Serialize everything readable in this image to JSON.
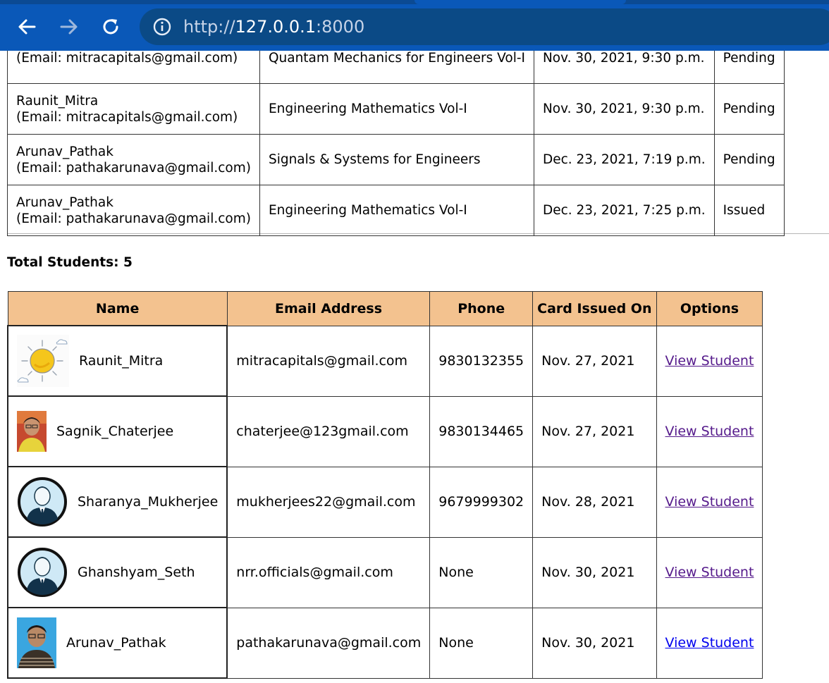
{
  "browser": {
    "url_prefix": "http://",
    "url_host": "127.0.0.1",
    "url_port": ":8000",
    "back_icon": "arrow-left-icon",
    "forward_icon": "arrow-right-icon",
    "reload_icon": "reload-icon",
    "info_icon": "info-icon"
  },
  "issue_requests": {
    "rows": [
      {
        "name": "",
        "email": "(Email: mitracapitals@gmail.com)",
        "book": "Quantam Mechanics for Engineers Vol-I",
        "date": "Nov. 30, 2021, 9:30 p.m.",
        "status": "Pending"
      },
      {
        "name": "Raunit_Mitra",
        "email": "(Email: mitracapitals@gmail.com)",
        "book": "Engineering Mathematics Vol-I",
        "date": "Nov. 30, 2021, 9:30 p.m.",
        "status": "Pending"
      },
      {
        "name": "Arunav_Pathak",
        "email": "(Email: pathakarunava@gmail.com)",
        "book": "Signals & Systems for Engineers",
        "date": "Dec. 23, 2021, 7:19 p.m.",
        "status": "Pending"
      },
      {
        "name": "Arunav_Pathak",
        "email": "(Email: pathakarunava@gmail.com)",
        "book": "Engineering Mathematics Vol-I",
        "date": "Dec. 23, 2021, 7:25 p.m.",
        "status": "Issued"
      }
    ]
  },
  "students": {
    "total_label": "Total Students: 5",
    "headers": [
      "Name",
      "Email Address",
      "Phone",
      "Card Issued On",
      "Options"
    ],
    "rows": [
      {
        "name": "Raunit_Mitra",
        "email": "mitracapitals@gmail.com",
        "phone": "9830132355",
        "issued": "Nov. 27, 2021",
        "option": "View Student",
        "avatar": "sun-avatar-icon"
      },
      {
        "name": "Sagnik_Chaterjee",
        "email": "chaterjee@123gmail.com",
        "phone": "9830134465",
        "issued": "Nov. 27, 2021",
        "option": "View Student",
        "avatar": "photo-avatar-icon"
      },
      {
        "name": "Sharanya_Mukherjee",
        "email": "mukherjees22@gmail.com",
        "phone": "9679999302",
        "issued": "Nov. 28, 2021",
        "option": "View Student",
        "avatar": "default-user-avatar-icon"
      },
      {
        "name": "Ghanshyam_Seth",
        "email": "nrr.officials@gmail.com",
        "phone": "None",
        "issued": "Nov. 30, 2021",
        "option": "View Student",
        "avatar": "default-user-avatar-icon"
      },
      {
        "name": "Arunav_Pathak",
        "email": "pathakarunava@gmail.com",
        "phone": "None",
        "issued": "Nov. 30, 2021",
        "option": "View Student",
        "avatar": "photo-avatar-icon"
      }
    ]
  },
  "colors": {
    "toolbar": "#0a58b8",
    "address_bar": "#0b4a86",
    "table_header": "#f3c28f",
    "visited_link": "#551a8b",
    "link": "#0000ee"
  }
}
